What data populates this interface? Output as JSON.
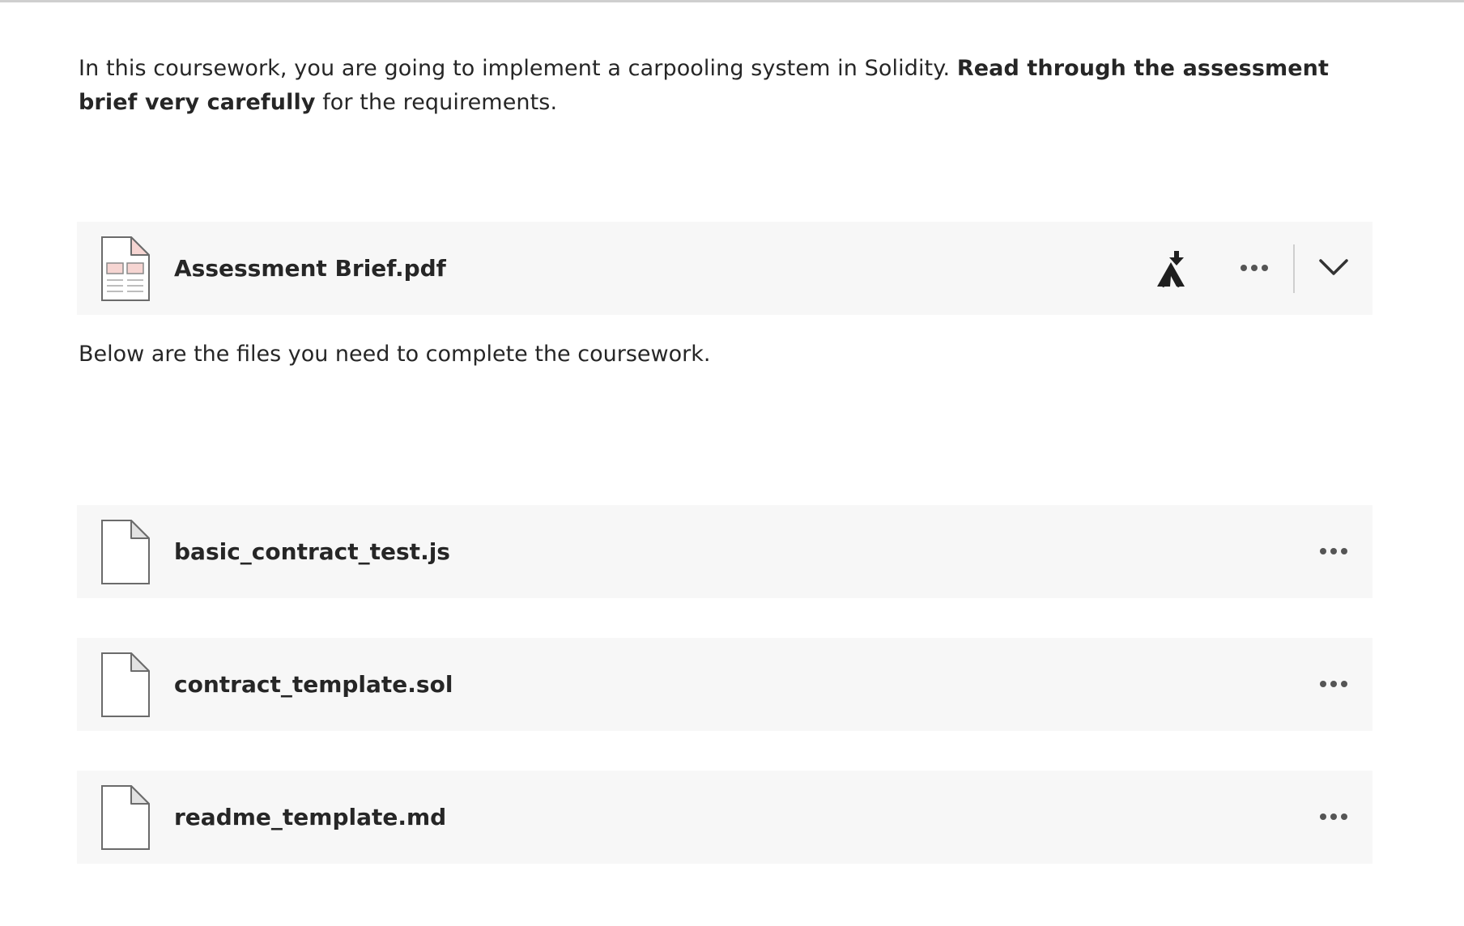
{
  "intro": {
    "text_before": "In this coursework, you are going to implement a carpooling system in Solidity. ",
    "bold": "Read through the assessment brief very carefully",
    "text_after": " for the requirements."
  },
  "brief_file": {
    "name": "Assessment Brief.pdf",
    "icons": [
      "pdf-file-icon",
      "alternative-formats-icon",
      "more-options-icon",
      "chevron-down-icon"
    ]
  },
  "note": "Below are the files you need to complete the coursework.",
  "files": [
    {
      "name": "basic_contract_test.js"
    },
    {
      "name": "contract_template.sol"
    },
    {
      "name": "readme_template.md"
    }
  ],
  "colors": {
    "row_background": "#f7f7f7",
    "text": "#262626",
    "pdf_accent": "#f6d5d2"
  }
}
